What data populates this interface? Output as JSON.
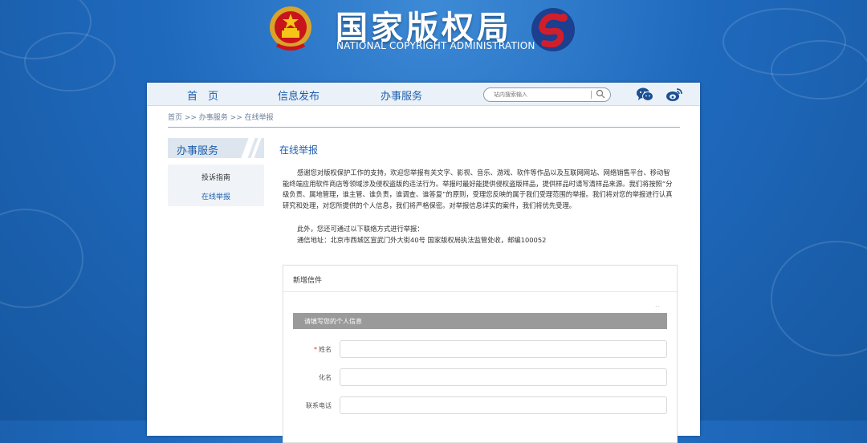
{
  "header": {
    "title_cn": "国家版权局",
    "title_en": "NATIONAL COPYRIGHT ADMINISTRATION"
  },
  "nav": {
    "items": [
      "首　页",
      "信息发布",
      "办事服务"
    ],
    "search_placeholder": "站内搜索输入"
  },
  "breadcrumb": "首页 >> 办事服务 >> 在线举报",
  "sidebar": {
    "heading": "办事服务",
    "items": [
      "投诉指南",
      "在线举报"
    ],
    "active_index": 1
  },
  "main": {
    "title": "在线举报",
    "paragraph1": "感谢您对版权保护工作的支持，欢迎您举报有关文字、影视、音乐、游戏、软件等作品以及互联网网站、网络销售平台、移动智能终端应用软件商店等领域涉及侵权盗版的违法行为。举报时最好能提供侵权盗版样品，提供样品时请写清样品来源。我们将按照“分级负责、属地管理，谁主管、谁负责，谁调查、谁答复”的原则，受理您反映的属于我们受理范围的举报。我们将对您的举报进行认真研究和处理，对您所提供的个人信息，我们将严格保密。对举报信息详实的案件，我们将优先受理。",
    "paragraph2": "此外，您还可通过以下联络方式进行举报：",
    "paragraph3": "通信地址：北京市西城区宣武门外大街40号 国家版权局执法监管处收，邮编100052"
  },
  "form": {
    "title": "新增信件",
    "dots": "..",
    "section_title": "请填写您的个人信息",
    "fields": [
      {
        "label": "姓名",
        "required": true,
        "value": ""
      },
      {
        "label": "化名",
        "required": false,
        "value": ""
      },
      {
        "label": "联系电话",
        "required": false,
        "value": ""
      }
    ],
    "required_mark": "*"
  },
  "colors": {
    "background": "#1f69bd",
    "accent": "#1e5fae",
    "section_bar": "#9a9a9a"
  },
  "icons": [
    "national-emblem-icon",
    "copyright-logo-icon",
    "search-icon",
    "wechat-icon",
    "weibo-icon"
  ]
}
